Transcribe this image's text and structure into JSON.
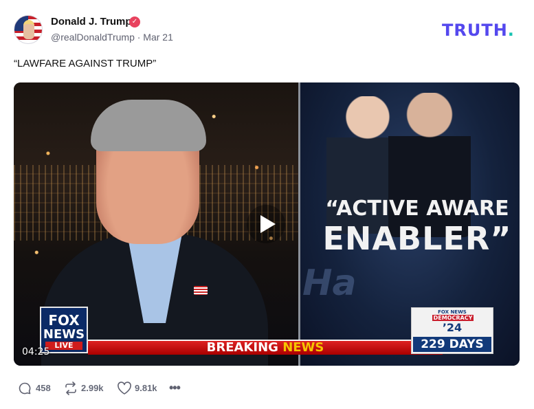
{
  "post": {
    "author_name": "Donald J. Trump",
    "verified_glyph": "✓",
    "handle_and_date": "@realDonaldTrump · Mar 21",
    "text": "“LAWFARE AGAINST TRUMP”"
  },
  "brand": {
    "logo_text": "TRUTH",
    "logo_dot": ".",
    "accent_color": "#5448ee",
    "dot_color": "#17c3b2"
  },
  "video": {
    "timestamp": "04:25",
    "headline_line1": "“ACTIVE AWARE",
    "headline_line2": "ENABLER”",
    "ghost_text": "Ha",
    "ticker_part1": "BREAKING ",
    "ticker_part2": "NEWS",
    "channel_logo": {
      "line1": "FOX",
      "line2": "NEWS",
      "line3": "LIVE"
    },
    "countdown": {
      "source": "FOX NEWS",
      "label": "DEMOCRACY",
      "year": "’24",
      "days": "229 DAYS"
    }
  },
  "actions": {
    "replies": "458",
    "retruths": "2.99k",
    "likes": "9.81k",
    "more": "•••"
  }
}
